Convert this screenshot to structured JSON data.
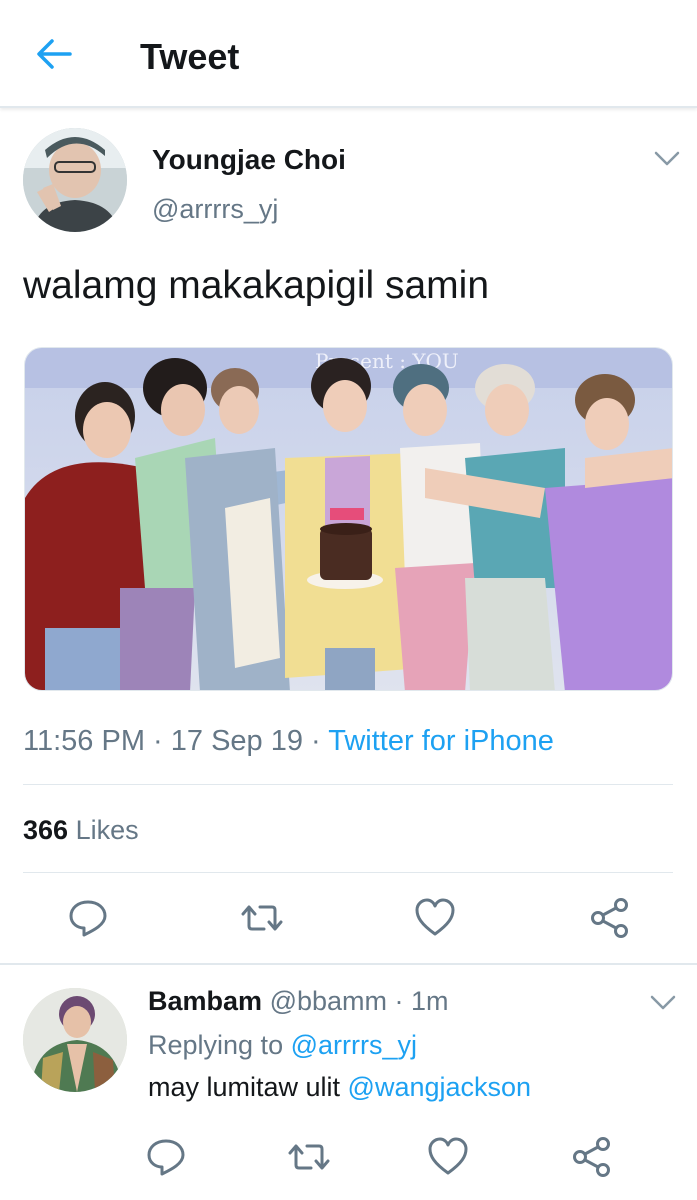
{
  "header": {
    "title": "Tweet",
    "back_icon": "arrow-left-icon"
  },
  "tweet": {
    "author_name": "Youngjae Choi",
    "author_handle": "@arrrrs_yj",
    "text": "walamg makakapigil samin",
    "image_caption_text": "Present : YOU",
    "time": "11:56 PM",
    "sep1": " · ",
    "date": "17 Sep 19",
    "sep2": " · ",
    "source": "Twitter for iPhone",
    "likes_count": "366",
    "likes_label": " Likes",
    "actions": [
      "reply-icon",
      "retweet-icon",
      "like-icon",
      "share-icon"
    ]
  },
  "reply": {
    "author_name": "Bambam",
    "author_handle": "@bbamm",
    "separator": " · ",
    "time": "1m",
    "replying_prefix": "Replying to ",
    "replying_to": "@arrrrs_yj",
    "text": "may lumitaw ulit ",
    "mention": "@wangjackson"
  },
  "colors": {
    "accent": "#1da1f2",
    "secondary_text": "#657786",
    "divider": "#e1e8ed"
  }
}
